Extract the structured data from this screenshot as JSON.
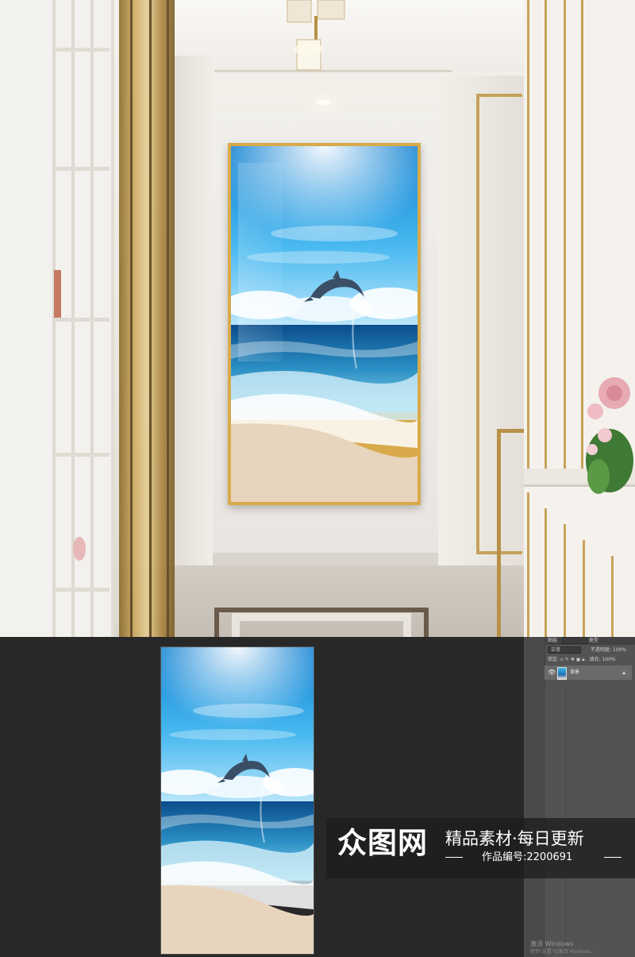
{
  "scene": {
    "description_icons": [
      "chandelier-icon",
      "dolphin-icon",
      "rose-flowers-icon"
    ]
  },
  "artwork": {
    "subject_icon": "dolphin-icon",
    "sky_colors": [
      "#0f7fd1",
      "#49b9f0",
      "#bfe8fb"
    ],
    "sea_colors": [
      "#0b4d8c",
      "#2a8fc4",
      "#8fd3ec"
    ],
    "sand_color": "#e8d5bd",
    "frame_color": "#d8aa4a"
  },
  "editor": {
    "panel": {
      "tab_label": "图层",
      "kind_label": "类型",
      "blend_mode": "正常",
      "opacity_label": "不透明度:",
      "opacity_value": "100%",
      "lock_label": "锁定:",
      "fill_label": "填充:",
      "fill_value": "100%",
      "layer_name": "背景"
    },
    "activation": {
      "line1": "激活 Windows",
      "line2": "转到\"设置\"以激活 Windows。"
    }
  },
  "watermark": {
    "logo": "众图网",
    "slogan": "精品素材·每日更新",
    "code": "作品编号:2200691"
  }
}
